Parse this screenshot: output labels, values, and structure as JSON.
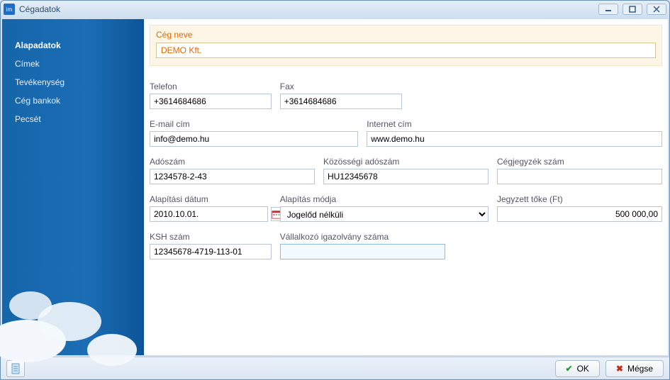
{
  "window": {
    "title": "Cégadatok"
  },
  "sidebar": {
    "items": [
      {
        "label": "Alapadatok",
        "selected": true
      },
      {
        "label": "Címek"
      },
      {
        "label": "Tevékenység"
      },
      {
        "label": "Cég bankok"
      },
      {
        "label": "Pecsét"
      }
    ]
  },
  "company": {
    "name_label": "Cég neve",
    "name_value": "DEMO Kft."
  },
  "fields": {
    "telefon": {
      "label": "Telefon",
      "value": "+3614684686"
    },
    "fax": {
      "label": "Fax",
      "value": "+3614684686"
    },
    "email": {
      "label": "E-mail cím",
      "value": "info@demo.hu"
    },
    "internet": {
      "label": "Internet cím",
      "value": "www.demo.hu"
    },
    "adoszam": {
      "label": "Adószám",
      "value": "1234578-2-43"
    },
    "kozossegi": {
      "label": "Közösségi adószám",
      "value": "HU12345678"
    },
    "cegjegyzek": {
      "label": "Cégjegyzék szám",
      "value": ""
    },
    "alapitasi_datum": {
      "label": "Alapítási dátum",
      "value": "2010.10.01."
    },
    "alapitas_modja": {
      "label": "Alapítás módja",
      "value": "Jogelőd nélküli"
    },
    "jegyzett_toke": {
      "label": "Jegyzett tőke (Ft)",
      "value": "500 000,00"
    },
    "ksh": {
      "label": "KSH szám",
      "value": "12345678-4719-113-01"
    },
    "vallalkozo": {
      "label": "Vállalkozó igazolvány száma",
      "value": ""
    }
  },
  "footer": {
    "ok": "OK",
    "cancel": "Mégse"
  }
}
